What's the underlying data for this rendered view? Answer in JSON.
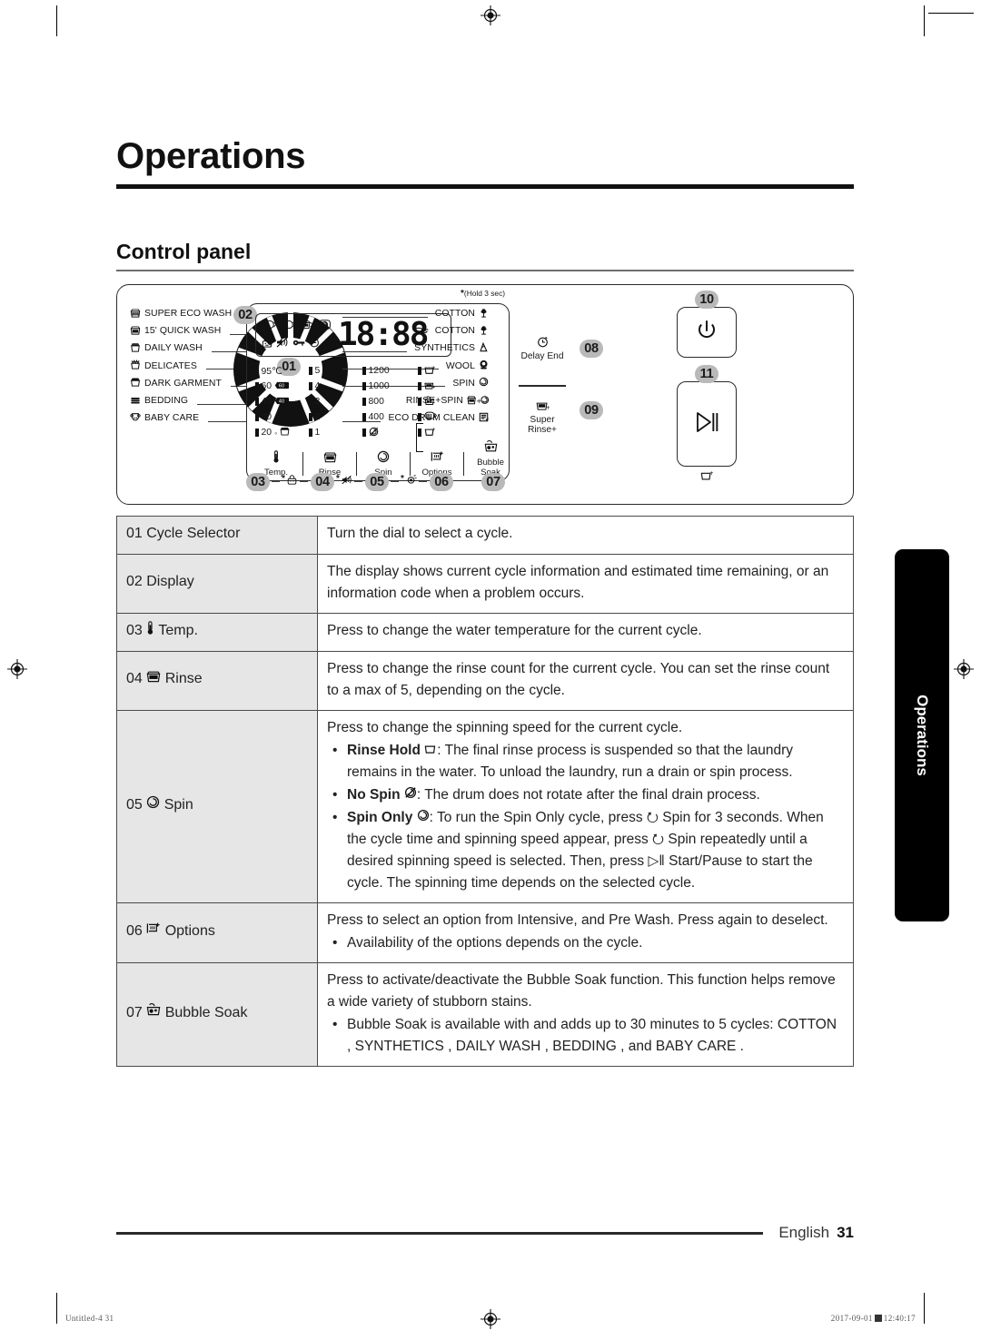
{
  "chapter": {
    "title": "Operations"
  },
  "section": {
    "title": "Control panel"
  },
  "panel": {
    "cycles_left": [
      {
        "icon": "super-eco-wash-icon",
        "label": "SUPER ECO WASH"
      },
      {
        "icon": "quick-wash-icon",
        "label": "15' QUICK WASH"
      },
      {
        "icon": "daily-wash-icon",
        "label": "DAILY WASH"
      },
      {
        "icon": "delicates-icon",
        "label": "DELICATES"
      },
      {
        "icon": "dark-garment-icon",
        "label": "DARK GARMENT"
      },
      {
        "icon": "bedding-icon",
        "label": "BEDDING"
      },
      {
        "icon": "baby-care-icon",
        "label": "BABY CARE"
      }
    ],
    "cycles_right": [
      {
        "label": "COTTON",
        "icon": "cotton-icon"
      },
      {
        "label": "COTTON",
        "icon": "eco-cotton-icon",
        "prefix": "eco-bubble-icon"
      },
      {
        "label": "SYNTHETICS",
        "icon": "synthetics-icon"
      },
      {
        "label": "WOOL",
        "icon": "wool-icon"
      },
      {
        "label": "SPIN",
        "icon": "spin-icon"
      },
      {
        "label": "RINSE+SPIN",
        "icon": "rinse-plus-spin-icon"
      },
      {
        "label": "ECO DRUM CLEAN",
        "icon": "eco-drum-clean-icon"
      }
    ],
    "callouts": {
      "c01": "01",
      "c02": "02",
      "c03": "03",
      "c04": "04",
      "c05": "05",
      "c06": "06",
      "c07": "07",
      "c08": "08",
      "c09": "09",
      "c10": "10",
      "c11": "11"
    },
    "hold_note": "(Hold 3 sec)",
    "hold_note_asterisk": "*",
    "display_value": "18:88",
    "temp_column": [
      "95℃",
      "60",
      "40",
      "30",
      "20"
    ],
    "temp_extra": [
      "",
      "60",
      "40",
      "",
      ""
    ],
    "rinse_column": [
      "5",
      "4",
      "3",
      "2",
      "1"
    ],
    "spin_column": [
      "1200",
      "1000",
      "800",
      "400",
      ""
    ],
    "button_labels": [
      {
        "label": "Temp.",
        "icon": "thermometer-icon"
      },
      {
        "label": "Rinse",
        "icon": "rinse-basket-icon"
      },
      {
        "label": "Spin",
        "icon": "spin-icon"
      },
      {
        "label": "Options",
        "icon": "options-icon"
      },
      {
        "label": "Bubble Soak",
        "icon": "bubble-soak-icon"
      }
    ],
    "delay_end": "Delay End",
    "super_rinse": "Super\nRinse+",
    "super_rinse_line1": "Super",
    "super_rinse_line2": "Rinse+",
    "power_icon": "power-icon",
    "start_icon": "start-pause-icon",
    "start_sub_icon": "rinse-hold-icon"
  },
  "table": {
    "rows": [
      {
        "num": "01",
        "key": "Cycle Selector",
        "key_icon": null,
        "intro": "Turn the dial to select a cycle.",
        "bullets": []
      },
      {
        "num": "02",
        "key": "Display",
        "key_icon": null,
        "intro": "The display shows current cycle information and estimated time remaining, or an information code when a problem occurs.",
        "bullets": []
      },
      {
        "num": "03",
        "key": "Temp.",
        "key_icon": "thermometer-icon",
        "intro": "Press to change the water temperature for the current cycle.",
        "bullets": []
      },
      {
        "num": "04",
        "key": "Rinse",
        "key_icon": "rinse-basket-icon",
        "intro": "Press to change the rinse count for the current cycle. You can set the rinse count to a max of 5, depending on the cycle.",
        "bullets": []
      },
      {
        "num": "05",
        "key": "Spin",
        "key_icon": "spin-icon",
        "intro": "Press to change the spinning speed for the current cycle.",
        "bullets": [
          {
            "bold": "Rinse Hold",
            "icon": "rinse-hold-icon",
            "text": ": The final rinse process is suspended so that the laundry remains in the water. To unload the laundry, run a drain or spin process."
          },
          {
            "bold": "No Spin",
            "icon": "no-spin-icon",
            "text": ": The drum does not rotate after the final drain process."
          },
          {
            "bold": "Spin Only",
            "icon": "spin-icon",
            "text": ": To run the Spin Only cycle, press ⭮ Spin for 3 seconds. When the cycle time and spinning speed appear, press ⭮ Spin repeatedly until a desired spinning speed is selected. Then, press ▷‖ Start/Pause to start the cycle. The spinning time depends on the selected cycle."
          }
        ]
      },
      {
        "num": "06",
        "key": "Options",
        "key_icon": "options-icon",
        "intro": "Press to select an option from Intensive, and Pre Wash. Press again to deselect.",
        "bullets": [
          {
            "bold": "",
            "icon": null,
            "text": "Availability of the options depends on the cycle."
          }
        ]
      },
      {
        "num": "07",
        "key": "Bubble Soak",
        "key_icon": "bubble-soak-icon",
        "intro": "Press to activate/deactivate the Bubble Soak function. This function helps remove a wide variety of stubborn stains.",
        "bullets": [
          {
            "bold": "",
            "icon": null,
            "text": "Bubble Soak is available with and adds up to 30 minutes to 5 cycles: COTTON , SYNTHETICS , DAILY WASH , BEDDING , and BABY CARE ."
          }
        ]
      }
    ]
  },
  "side_tab": {
    "label": "Operations"
  },
  "footer": {
    "language": "English",
    "page": "31"
  },
  "print_marks": {
    "left": "Untitled-4   31",
    "right_date": "2017-09-01",
    "right_time": "12:40:17"
  }
}
